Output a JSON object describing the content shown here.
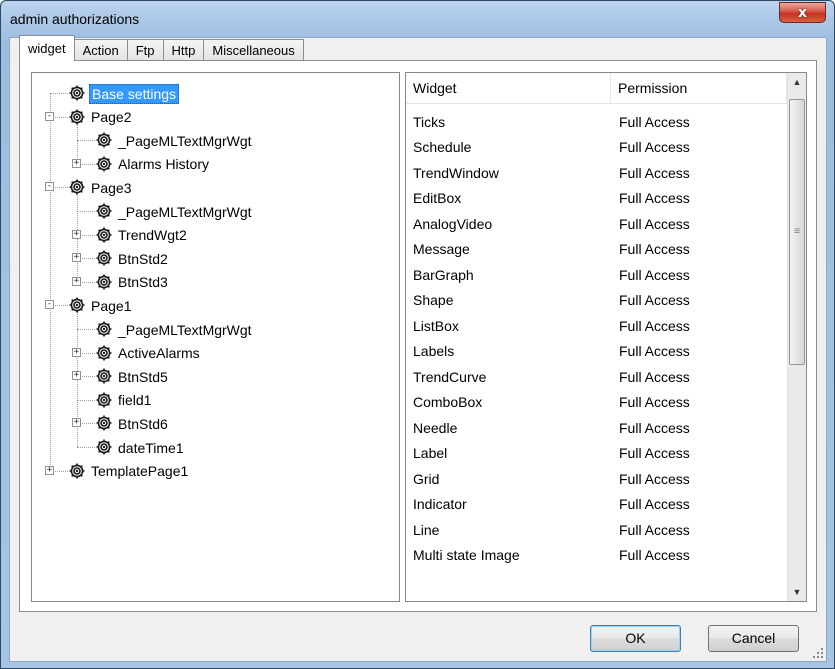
{
  "window": {
    "title": "admin authorizations",
    "close_label": "x"
  },
  "tabs": [
    "widget",
    "Action",
    "Ftp",
    "Http",
    "Miscellaneous"
  ],
  "tree": [
    {
      "label": "Base settings",
      "selected": true
    },
    {
      "label": "Page2"
    },
    {
      "label": "_PageMLTextMgrWgt"
    },
    {
      "label": "Alarms History"
    },
    {
      "label": "Page3"
    },
    {
      "label": "_PageMLTextMgrWgt"
    },
    {
      "label": "TrendWgt2"
    },
    {
      "label": "BtnStd2"
    },
    {
      "label": "BtnStd3"
    },
    {
      "label": "Page1"
    },
    {
      "label": "_PageMLTextMgrWgt"
    },
    {
      "label": "ActiveAlarms"
    },
    {
      "label": "BtnStd5"
    },
    {
      "label": "field1"
    },
    {
      "label": "BtnStd6"
    },
    {
      "label": "dateTime1"
    },
    {
      "label": "TemplatePage1"
    }
  ],
  "list": {
    "columns": [
      "Widget",
      "Permission"
    ],
    "rows": [
      [
        "Ticks",
        "Full Access"
      ],
      [
        "Schedule",
        "Full Access"
      ],
      [
        "TrendWindow",
        "Full Access"
      ],
      [
        "EditBox",
        "Full Access"
      ],
      [
        "AnalogVideo",
        "Full Access"
      ],
      [
        "Message",
        "Full Access"
      ],
      [
        "BarGraph",
        "Full Access"
      ],
      [
        "Shape",
        "Full Access"
      ],
      [
        "ListBox",
        "Full Access"
      ],
      [
        "Labels",
        "Full Access"
      ],
      [
        "TrendCurve",
        "Full Access"
      ],
      [
        "ComboBox",
        "Full Access"
      ],
      [
        "Needle",
        "Full Access"
      ],
      [
        "Label",
        "Full Access"
      ],
      [
        "Grid",
        "Full Access"
      ],
      [
        "Indicator",
        "Full Access"
      ],
      [
        "Line",
        "Full Access"
      ],
      [
        "Multi state Image",
        "Full Access"
      ]
    ]
  },
  "buttons": {
    "ok": "OK",
    "cancel": "Cancel"
  },
  "colors": {
    "selection": "#3399ff",
    "title_gradient": "#a9c6e6",
    "close_red": "#c53320"
  }
}
